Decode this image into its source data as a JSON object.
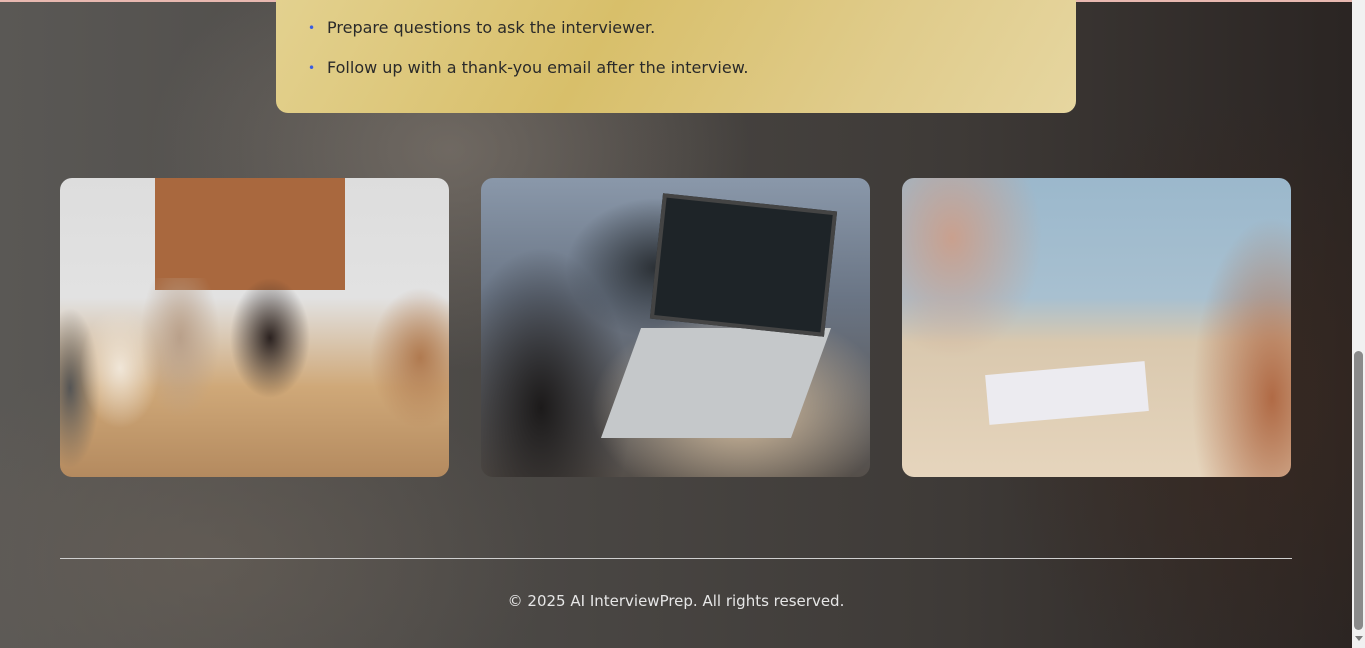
{
  "tips": [
    "Prepare questions to ask the interviewer.",
    "Follow up with a thank-you email after the interview."
  ],
  "bullet": "•",
  "gallery": [
    "team meeting handshake photo",
    "laptop with code photo",
    "interview at table photo"
  ],
  "footer": {
    "copyright": "© 2025 AI InterviewPrep. All rights reserved."
  }
}
